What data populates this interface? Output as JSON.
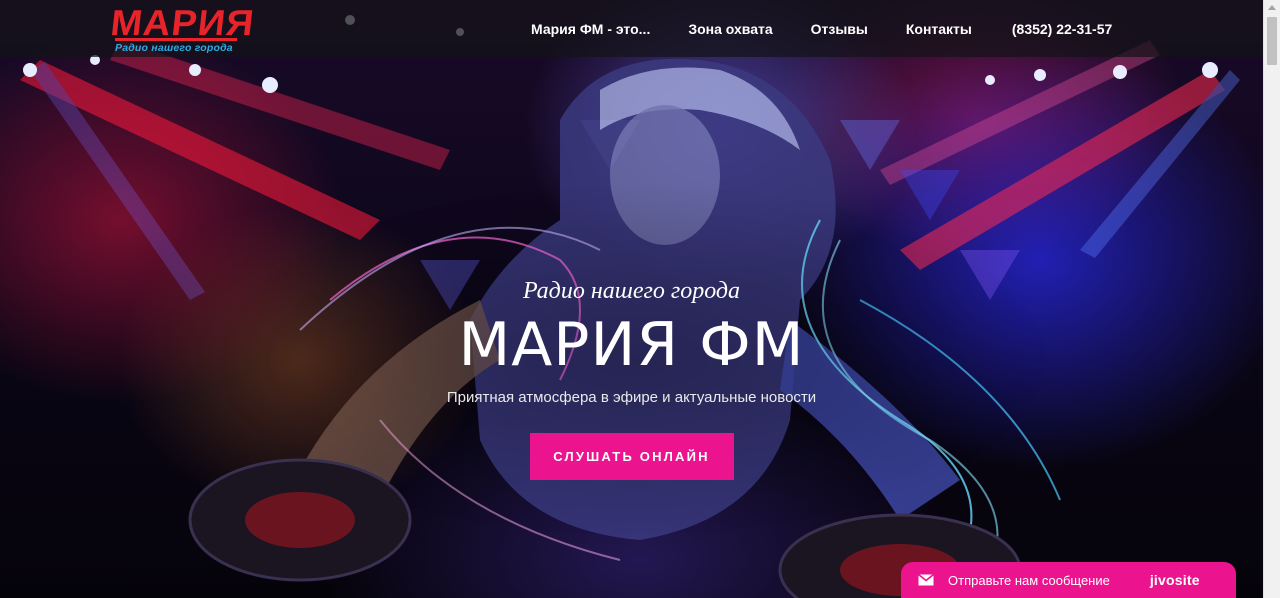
{
  "logo": {
    "word": "МАРИЯ",
    "subtitle": "Радио нашего города"
  },
  "nav": {
    "items": [
      {
        "label": "Мария ФМ - это..."
      },
      {
        "label": "Зона охвата"
      },
      {
        "label": "Отзывы"
      },
      {
        "label": "Контакты"
      }
    ],
    "phone": "(8352) 22-31-57"
  },
  "hero": {
    "tagline": "Радио нашего города",
    "title": "МАРИЯ ФМ",
    "subtitle": "Приятная атмосфера в эфире и актуальные новости",
    "button_label": "СЛУШАТЬ ОНЛАЙН"
  },
  "chat": {
    "label": "Отправьте нам сообщение",
    "brand": "jivosite",
    "icon": "envelope-icon"
  },
  "colors": {
    "logo_red": "#e8242a",
    "logo_blue": "#2ea9e6",
    "accent_pink": "#ec138f",
    "header_bg": "#141418"
  }
}
